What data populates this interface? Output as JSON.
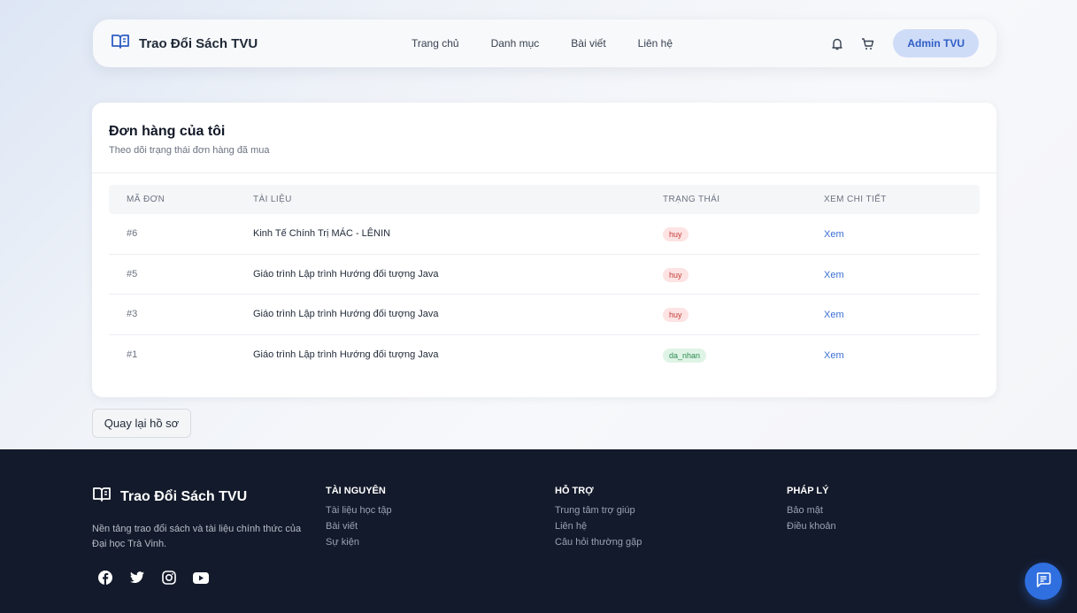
{
  "header": {
    "brand": "Trao Đổi Sách TVU",
    "nav": [
      {
        "label": "Trang chủ"
      },
      {
        "label": "Danh mục"
      },
      {
        "label": "Bài viết"
      },
      {
        "label": "Liên hệ"
      }
    ],
    "user_label": "Admin TVU",
    "icons": {
      "logo": "book-icon",
      "notification": "bell-icon",
      "cart": "cart-icon"
    }
  },
  "orders": {
    "title": "Đơn hàng của tôi",
    "subtitle": "Theo dõi trạng thái đơn hàng đã mua",
    "columns": [
      "MÃ ĐƠN",
      "TÀI LIỆU",
      "TRẠNG THÁI",
      "XEM CHI TIẾT"
    ],
    "rows": [
      {
        "id": "#6",
        "title": "Kinh Tế Chính Trị MÁC - LÊNIN",
        "status": "huy",
        "action": "Xem"
      },
      {
        "id": "#5",
        "title": "Giáo trình Lập trình Hướng đối tượng Java",
        "status": "huy",
        "action": "Xem"
      },
      {
        "id": "#3",
        "title": "Giáo trình Lập trình Hướng đối tượng Java",
        "status": "huy",
        "action": "Xem"
      },
      {
        "id": "#1",
        "title": "Giáo trình Lập trình Hướng đối tượng Java",
        "status": "da_nhan",
        "action": "Xem"
      }
    ],
    "back_label": "Quay lại hồ sơ"
  },
  "footer": {
    "brand": "Trao Đổi Sách TVU",
    "description": "Nền tảng trao đổi sách và tài liệu chính thức của Đại học Trà Vinh.",
    "columns": [
      {
        "title": "TÀI NGUYÊN",
        "links": [
          "Tài liệu học tập",
          "Bài viết",
          "Sự kiện"
        ]
      },
      {
        "title": "HỖ TRỢ",
        "links": [
          "Trung tâm trợ giúp",
          "Liên hệ",
          "Câu hỏi thường gặp"
        ]
      },
      {
        "title": "PHÁP LÝ",
        "links": [
          "Bảo mật",
          "Điều khoản"
        ]
      }
    ],
    "social_icons": [
      "facebook-icon",
      "twitter-icon",
      "instagram-icon",
      "youtube-icon"
    ]
  },
  "chat": {
    "icon": "chat-icon"
  },
  "colors": {
    "accent": "#3b6fd4",
    "footer_bg": "#131a2b",
    "status_cancel_bg": "#fde3e3",
    "status_received_bg": "#dff4e6"
  }
}
